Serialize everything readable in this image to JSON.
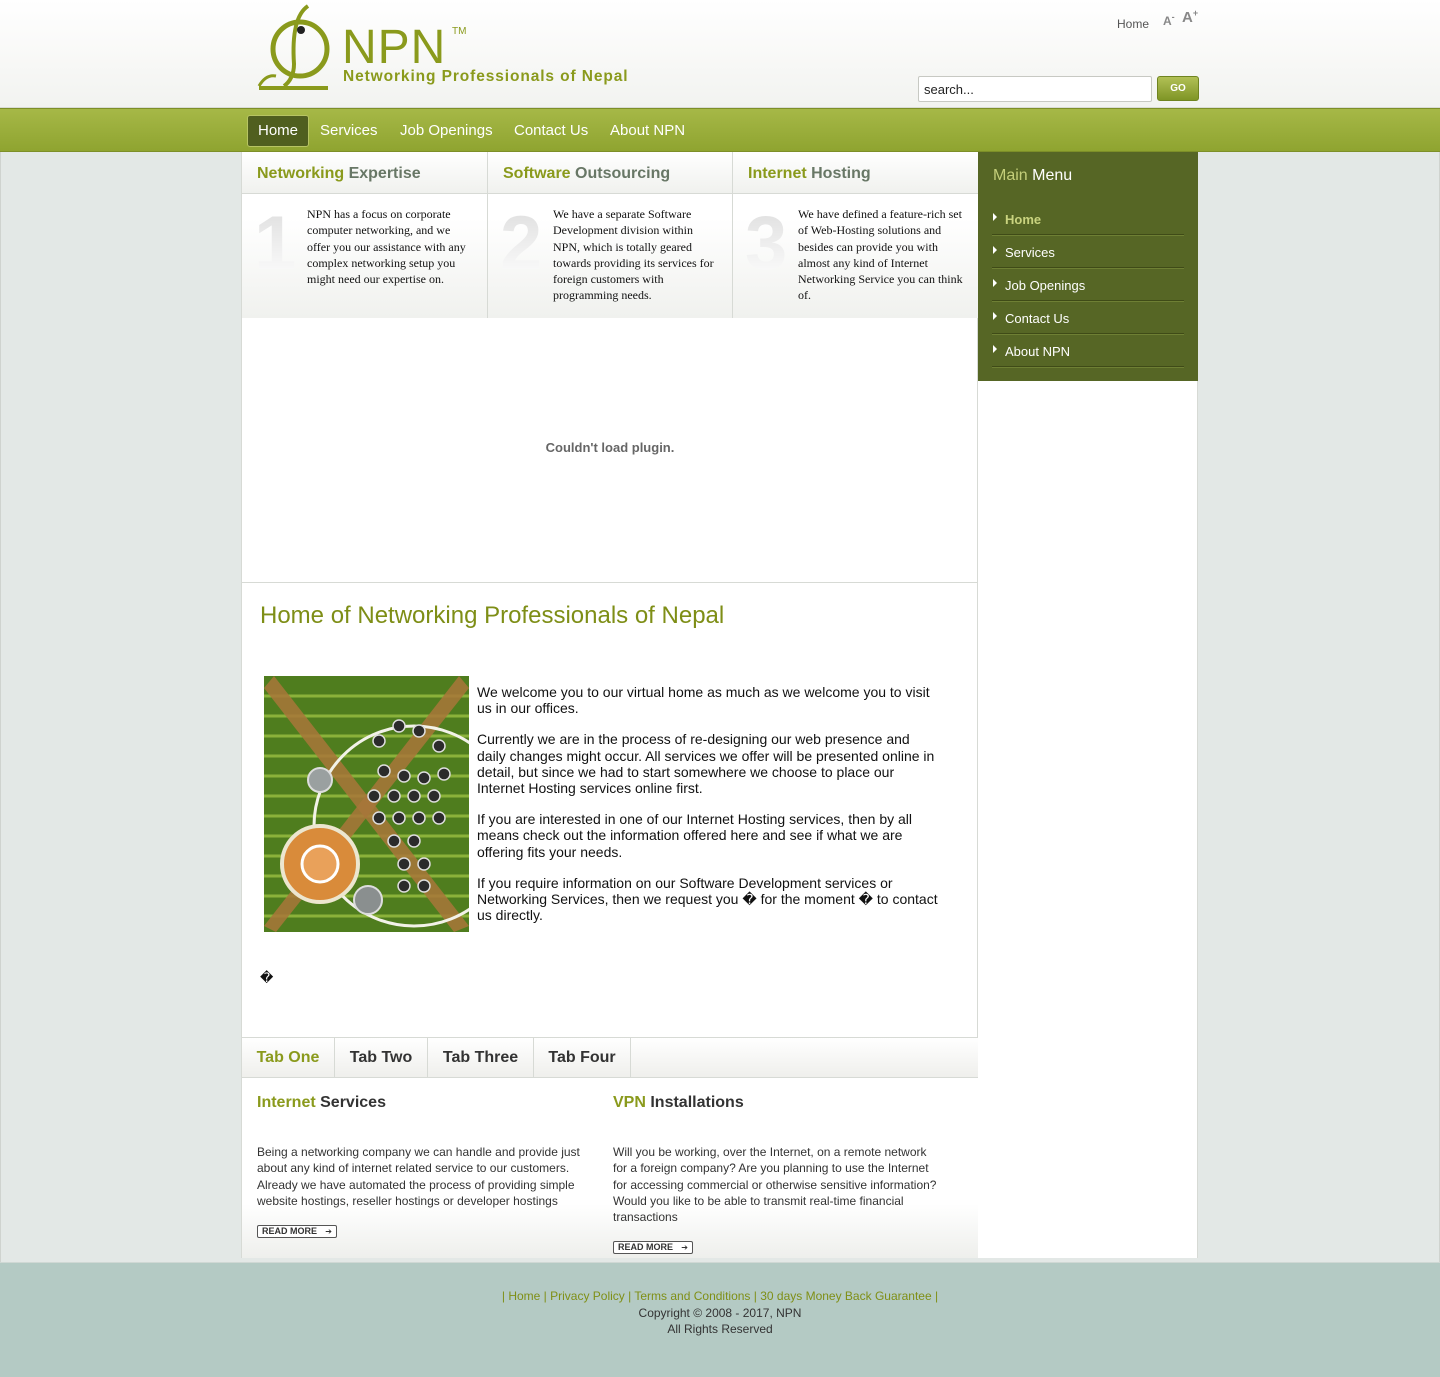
{
  "header": {
    "logo_name": "NPN",
    "logo_tm": "TM",
    "logo_tagline": "Networking Professionals of Nepal",
    "top_home": "Home",
    "font_smaller": "A",
    "font_smaller_sign": "-",
    "font_larger": "A",
    "font_larger_sign": "+",
    "search_value": "search...",
    "search_button": "GO"
  },
  "nav": {
    "items": [
      {
        "label": "Home",
        "active": true
      },
      {
        "label": "Services"
      },
      {
        "label": "Job Openings"
      },
      {
        "label": "Contact Us"
      },
      {
        "label": "About NPN"
      }
    ]
  },
  "features": [
    {
      "title_hl": "Networking",
      "title_rest": "Expertise",
      "number": "1",
      "text": "NPN has a focus on corporate computer networking, and we offer you our assistance with any complex networking setup you might need our expertise on."
    },
    {
      "title_hl": "Software",
      "title_rest": "Outsourcing",
      "number": "2",
      "text": "We have a separate Software Development division within NPN, which is totally geared towards providing its services for foreign customers with programming needs."
    },
    {
      "title_hl": "Internet",
      "title_rest": "Hosting",
      "number": "3",
      "text": "We have defined a feature-rich set of Web-Hosting solutions and besides can provide you with almost any kind of Internet Networking Service you can think of."
    }
  ],
  "plugin": {
    "message": "Couldn't load plugin."
  },
  "article": {
    "title": "Home of Networking Professionals of Nepal",
    "paragraphs": [
      "We welcome you to our virtual home as much as we welcome you to visit us in our offices.",
      "Currently we are in the process of re-designing our web presence and daily changes might occur. All services we offer will be presented online in detail, but since we had to start somewhere we choose to place our Internet Hosting services online first.",
      "If you are interested in one of our Internet Hosting services, then by all means check out the information offered here and see if what we are offering fits your needs.",
      "If you require information on our Software Development services or Networking Services, then we request you � for the moment � to contact us directly."
    ],
    "stray": "�"
  },
  "tabs": {
    "items": [
      {
        "label": "Tab One",
        "active": true
      },
      {
        "label": "Tab Two"
      },
      {
        "label": "Tab Three"
      },
      {
        "label": "Tab Four"
      }
    ],
    "columns": [
      {
        "title_hl": "Internet",
        "title_rest": "Services",
        "text": "Being a networking company we can handle and provide just about any kind of internet related service to our customers. Already we have automated the process of providing simple website hostings, reseller hostings or developer hostings",
        "read_more": "READ MORE"
      },
      {
        "title_hl": "VPN",
        "title_rest": "Installations",
        "text": "Will you be working, over the Internet, on a remote network for a foreign company? Are you planning to use the Internet for accessing commercial or otherwise sensitive information? Would you like to be able to transmit real-time financial transactions",
        "read_more": "READ MORE"
      }
    ]
  },
  "sidebar": {
    "title_hl": "Main",
    "title_rest": "Menu",
    "items": [
      {
        "label": "Home",
        "active": true
      },
      {
        "label": "Services"
      },
      {
        "label": "Job Openings"
      },
      {
        "label": "Contact Us"
      },
      {
        "label": "About NPN"
      }
    ]
  },
  "footer": {
    "links_text": "| Home | Privacy Policy | Terms and Conditions | 30 days Money Back Guarantee |",
    "copyright": "Copyright © 2008 - 2017, NPN",
    "rights": "All Rights Reserved"
  },
  "colors": {
    "brand_green": "#8a9a1c",
    "nav_green": "#9aae3a",
    "sidebar_dark": "#566625",
    "footer_bg": "#b4cac4"
  }
}
